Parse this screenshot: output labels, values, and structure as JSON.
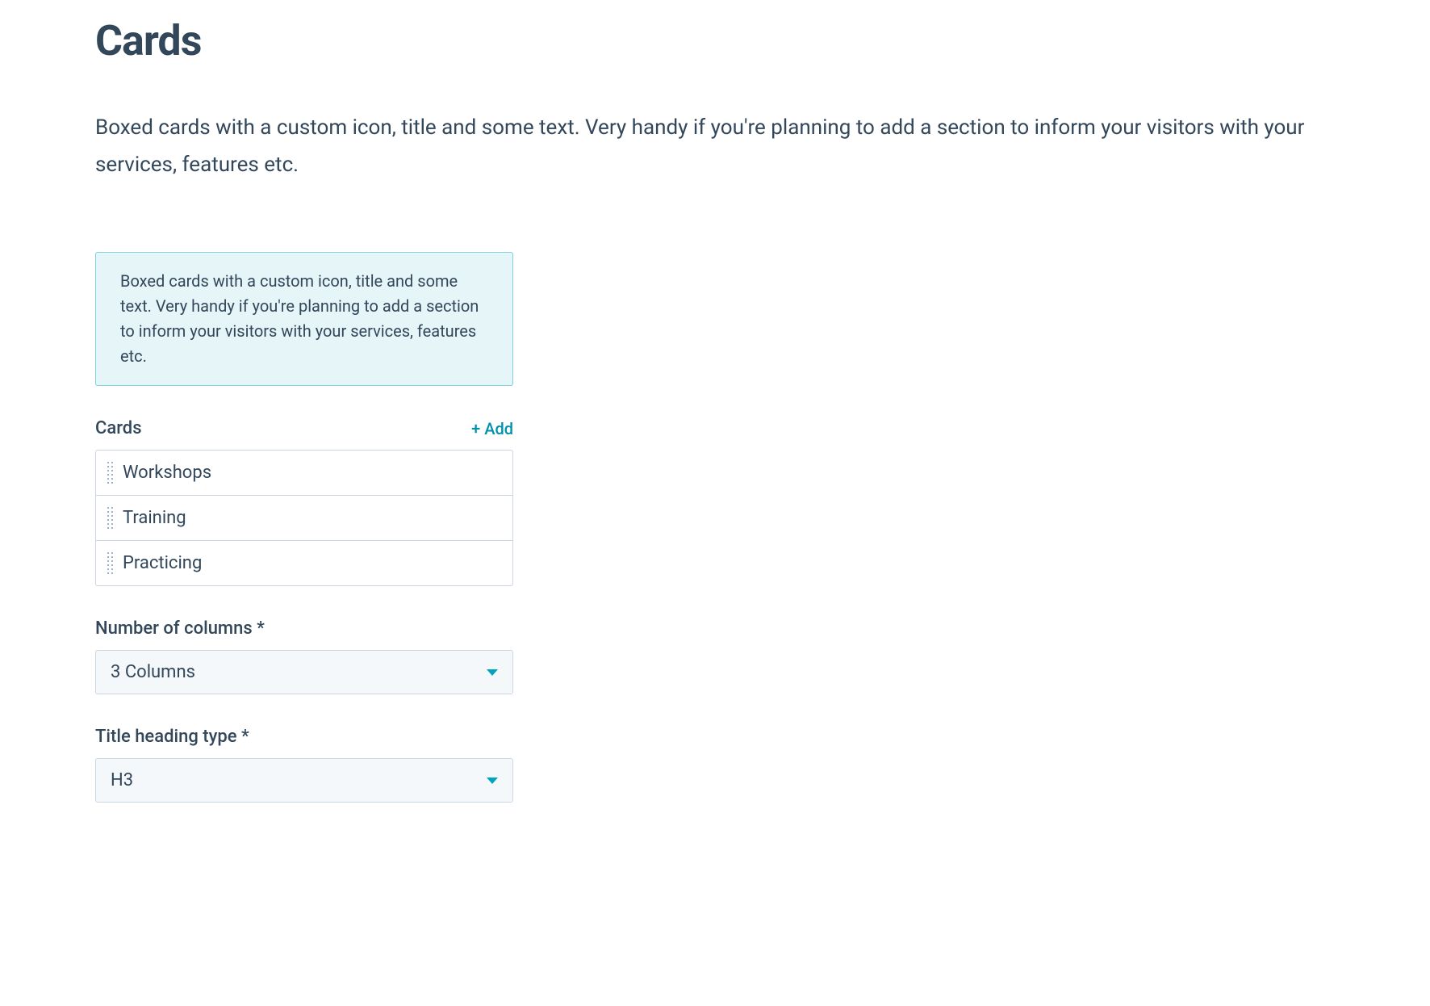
{
  "page": {
    "title": "Cards",
    "description": "Boxed cards with a custom icon, title and some text. Very handy if you're planning to add a section to inform your visitors with your services, features etc."
  },
  "info_box": {
    "text": "Boxed cards with a custom icon, title and some text. Very handy if you're planning to add a section to inform your visitors with your services, features etc."
  },
  "cards_section": {
    "label": "Cards",
    "add_label": "+ Add",
    "items": [
      {
        "label": "Workshops"
      },
      {
        "label": "Training"
      },
      {
        "label": "Practicing"
      }
    ]
  },
  "columns_field": {
    "label": "Number of columns *",
    "value": "3 Columns"
  },
  "heading_field": {
    "label": "Title heading type *",
    "value": "H3"
  }
}
